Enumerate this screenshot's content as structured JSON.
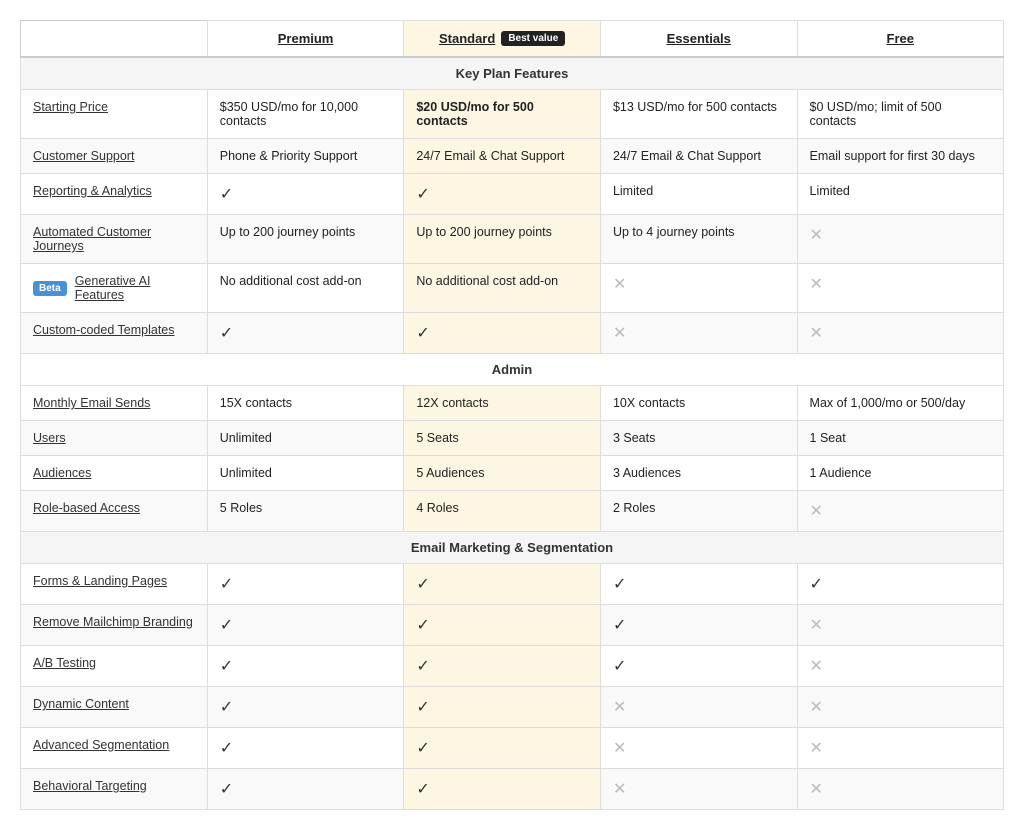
{
  "plans": {
    "premium": {
      "label": "Premium"
    },
    "standard": {
      "label": "Standard",
      "badge": "Best value"
    },
    "essentials": {
      "label": "Essentials"
    },
    "free": {
      "label": "Free"
    }
  },
  "sections": [
    {
      "title": "Key Plan Features",
      "rows": [
        {
          "feature": "Starting Price",
          "premium": "$350 USD/mo for 10,000 contacts",
          "standard": "$20 USD/mo for 500 contacts",
          "essentials": "$13 USD/mo for 500 contacts",
          "free": "$0 USD/mo; limit of 500 contacts",
          "standard_bold": true
        },
        {
          "feature": "Customer Support",
          "premium": "Phone & Priority Support",
          "standard": "24/7 Email & Chat Support",
          "essentials": "24/7 Email & Chat Support",
          "free": "Email support for first 30 days"
        },
        {
          "feature": "Reporting & Analytics",
          "premium": "check",
          "standard": "check",
          "essentials": "Limited",
          "free": "Limited"
        },
        {
          "feature": "Automated Customer Journeys",
          "premium": "Up to 200 journey points",
          "standard": "Up to 200 journey points",
          "essentials": "Up to 4 journey points",
          "free": "x"
        },
        {
          "feature": "Generative AI Features",
          "beta": true,
          "premium": "No additional cost add-on",
          "standard": "No additional cost add-on",
          "essentials": "x",
          "free": "x"
        },
        {
          "feature": "Custom-coded Templates",
          "premium": "check",
          "standard": "check",
          "essentials": "x",
          "free": "x"
        }
      ]
    },
    {
      "title": "Admin",
      "rows": [
        {
          "feature": "Monthly Email Sends",
          "premium": "15X contacts",
          "standard": "12X contacts",
          "essentials": "10X contacts",
          "free": "Max of 1,000/mo or 500/day"
        },
        {
          "feature": "Users",
          "premium": "Unlimited",
          "standard": "5 Seats",
          "essentials": "3 Seats",
          "free": "1 Seat"
        },
        {
          "feature": "Audiences",
          "premium": "Unlimited",
          "standard": "5 Audiences",
          "essentials": "3 Audiences",
          "free": "1 Audience"
        },
        {
          "feature": "Role-based Access",
          "premium": "5 Roles",
          "standard": "4 Roles",
          "essentials": "2 Roles",
          "free": "x"
        }
      ]
    },
    {
      "title": "Email Marketing & Segmentation",
      "rows": [
        {
          "feature": "Forms & Landing Pages",
          "premium": "check",
          "standard": "check",
          "essentials": "check",
          "free": "check"
        },
        {
          "feature": "Remove Mailchimp Branding",
          "premium": "check",
          "standard": "check",
          "essentials": "check",
          "free": "x"
        },
        {
          "feature": "A/B Testing",
          "premium": "check",
          "standard": "check",
          "essentials": "check",
          "free": "x"
        },
        {
          "feature": "Dynamic Content",
          "premium": "check",
          "standard": "check",
          "essentials": "x",
          "free": "x"
        },
        {
          "feature": "Advanced Segmentation",
          "premium": "check",
          "standard": "check",
          "essentials": "x",
          "free": "x"
        },
        {
          "feature": "Behavioral Targeting",
          "premium": "check",
          "standard": "check",
          "essentials": "x",
          "free": "x"
        }
      ]
    }
  ]
}
